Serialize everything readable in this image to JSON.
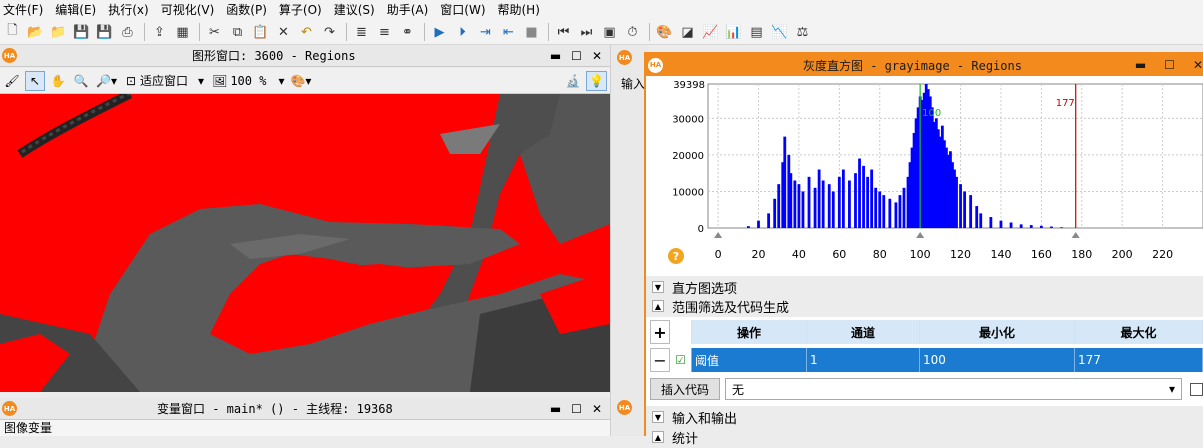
{
  "menu": [
    "文件(F)",
    "编辑(E)",
    "执行(x)",
    "可视化(V)",
    "函数(P)",
    "算子(O)",
    "建议(S)",
    "助手(A)",
    "窗口(W)",
    "帮助(H)"
  ],
  "graphics_window": {
    "title": "图形窗口: 3600 - Regions",
    "fit_label": "适应窗口",
    "zoom": "100 %"
  },
  "variable_window": {
    "title": "变量窗口 - main* () - 主线程: 19368",
    "section": "图像变量"
  },
  "behind_text": "输入",
  "histogram": {
    "title": "灰度直方图 - grayimage - Regions",
    "y_max_label": "39398",
    "y_ticks": [
      "30000",
      "20000",
      "10000",
      "0"
    ],
    "x_ticks": [
      "0",
      "20",
      "40",
      "60",
      "80",
      "100",
      "120",
      "140",
      "160",
      "180",
      "200",
      "220"
    ],
    "min_label": "100",
    "max_label": "177",
    "colors": {
      "bars": "#0000ff",
      "min_line": "#22bb22",
      "max_line": "#cc0000",
      "frame": "#f28a1e"
    }
  },
  "chart_data": {
    "type": "bar",
    "title": "灰度直方图 - grayimage - Regions",
    "x": [
      10,
      15,
      20,
      25,
      28,
      30,
      32,
      33,
      35,
      36,
      38,
      40,
      42,
      45,
      48,
      50,
      52,
      55,
      57,
      60,
      62,
      65,
      68,
      70,
      72,
      74,
      76,
      78,
      80,
      82,
      85,
      88,
      90,
      92,
      94,
      95,
      96,
      97,
      98,
      99,
      100,
      101,
      102,
      103,
      104,
      105,
      106,
      107,
      108,
      109,
      110,
      111,
      112,
      113,
      114,
      115,
      116,
      117,
      118,
      120,
      122,
      125,
      128,
      130,
      135,
      140,
      145,
      150,
      155,
      160,
      165,
      170,
      175
    ],
    "values": [
      0,
      500,
      2000,
      4000,
      8000,
      12000,
      18000,
      25000,
      20000,
      15000,
      13000,
      12000,
      10000,
      14000,
      11000,
      16000,
      13000,
      12000,
      10000,
      14000,
      16000,
      13000,
      15000,
      19000,
      17000,
      14000,
      16000,
      11000,
      10000,
      9000,
      8000,
      7000,
      9000,
      11000,
      14000,
      18000,
      22000,
      26000,
      30000,
      33000,
      36000,
      35000,
      37000,
      39398,
      38000,
      36000,
      33000,
      29000,
      30000,
      27000,
      25000,
      28000,
      24000,
      22000,
      20000,
      21000,
      18000,
      16000,
      14000,
      12000,
      10000,
      9000,
      6000,
      4000,
      3000,
      2000,
      1500,
      1000,
      800,
      600,
      400,
      200,
      0
    ],
    "xlim": [
      -5,
      240
    ],
    "ylim": [
      0,
      39398
    ],
    "range_min": 100,
    "range_max": 177,
    "grid": true
  },
  "sections": {
    "hist_options": "直方图选项",
    "range_filter": "范围筛选及代码生成",
    "io": "输入和输出",
    "stats": "统计"
  },
  "table": {
    "headers": [
      "操作",
      "通道",
      "最小化",
      "最大化"
    ],
    "row": {
      "op": "阈值",
      "channel": "1",
      "min": "100",
      "max": "177"
    },
    "add": "+",
    "remove": "−"
  },
  "insert": {
    "button": "插入代码",
    "value": "无"
  }
}
